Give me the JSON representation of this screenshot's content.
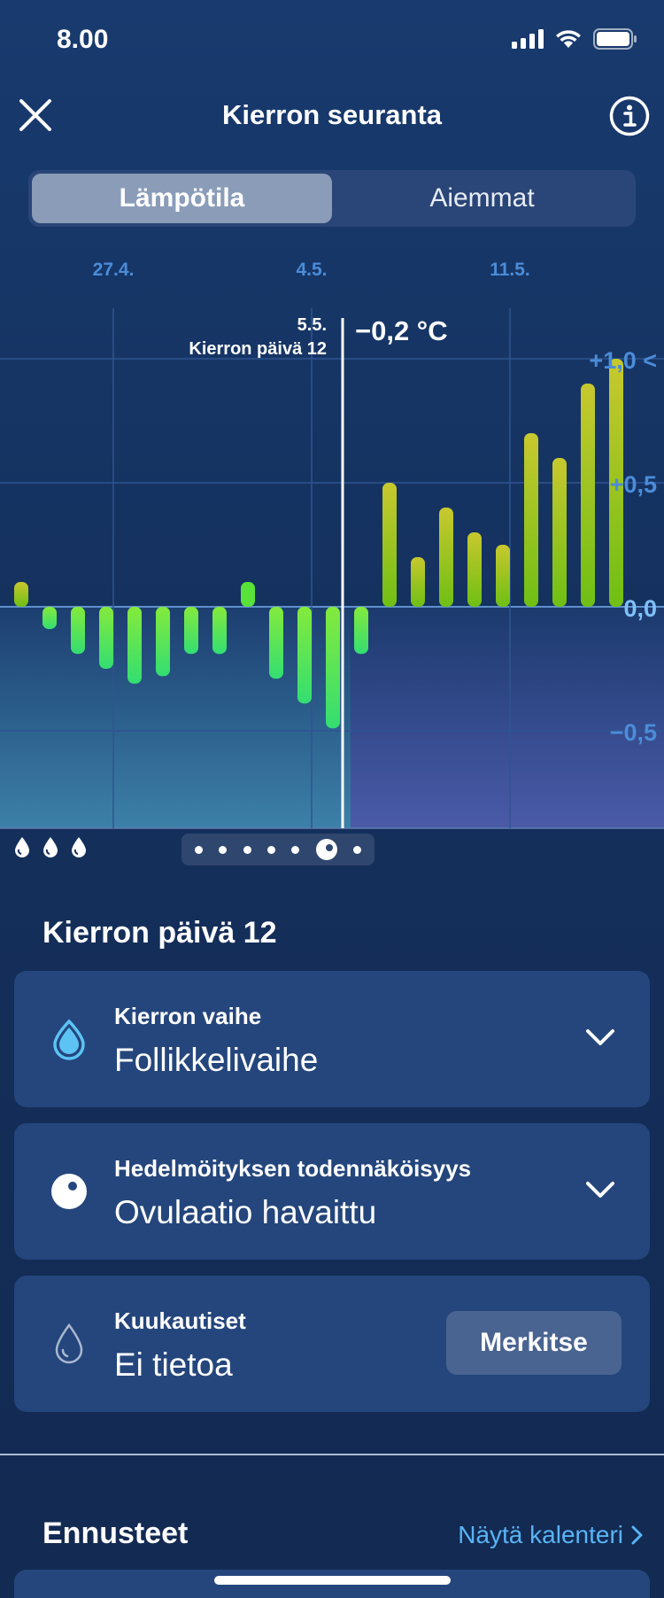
{
  "status_bar": {
    "time": "8.00"
  },
  "nav": {
    "title": "Kierron seuranta"
  },
  "tabs": [
    {
      "label": "Lämpötila",
      "active": true
    },
    {
      "label": "Aiemmat",
      "active": false
    }
  ],
  "chart_data": {
    "type": "bar",
    "x_tick_labels": [
      "27.4.",
      "4.5.",
      "11.5."
    ],
    "y_tick_labels": [
      "+1,0 <",
      "+0,5",
      "0,0",
      "−0,5"
    ],
    "yticks": [
      1.0,
      0.5,
      0.0,
      -0.5
    ],
    "ylim": [
      -0.9,
      1.1
    ],
    "grid": true,
    "selection": {
      "date": "5.5.",
      "day_label": "Kierron päivä 12",
      "value_label": "−0,2 °C"
    },
    "values": [
      0.1,
      -0.09,
      -0.19,
      -0.25,
      -0.31,
      -0.28,
      -0.19,
      -0.19,
      0.1,
      -0.29,
      -0.39,
      -0.49,
      -0.19,
      0.5,
      0.2,
      0.4,
      0.3,
      0.25,
      0.7,
      0.6,
      0.9,
      1.0
    ],
    "tick_day_index": {
      "27.4.": 3,
      "4.5.": 10,
      "11.5.": 17
    },
    "selected_index": 11,
    "colors": {
      "negative": "#43e46c",
      "positive": "#8ac81e",
      "positive_high": "#bdc82a"
    }
  },
  "pager": {
    "count": 7,
    "current": 6
  },
  "section_title": "Kierron päivä 12",
  "cards": {
    "phase": {
      "label": "Kierron vaihe",
      "value": "Follikkelivaihe",
      "icon": "drop-filled-icon"
    },
    "fertility": {
      "label": "Hedelmöityksen todennäköisyys",
      "value": "Ovulaatio havaittu",
      "icon": "egg-icon"
    },
    "period": {
      "label": "Kuukautiset",
      "value": "Ei tietoa",
      "button": "Merkitse",
      "icon": "drop-outline-icon"
    }
  },
  "forecast": {
    "title": "Ennusteet",
    "link": "Näytä kalenteri"
  }
}
